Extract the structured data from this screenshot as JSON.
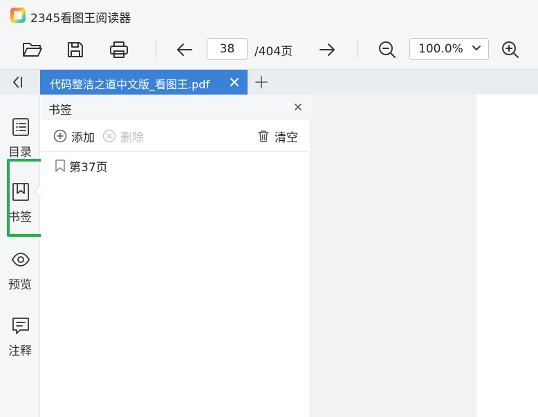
{
  "app": {
    "title": "2345看图王阅读器"
  },
  "toolbar": {
    "page_current": "38",
    "page_total": "/404页",
    "zoom": "100.0%",
    "icons": [
      "folder-open-icon",
      "save-icon",
      "print-icon",
      "arrow-left-icon",
      "arrow-right-icon",
      "zoom-out-icon",
      "chevron-down-icon",
      "zoom-in-icon"
    ]
  },
  "tabs": {
    "active_label": "代码整洁之道中文版_看图王.pdf",
    "close_icon": "close-icon",
    "add_icon": "plus-icon"
  },
  "sidebar": {
    "items": [
      {
        "label": "目录",
        "icon": "list-icon"
      },
      {
        "label": "书签",
        "icon": "bookmark-icon",
        "selected": true
      },
      {
        "label": "预览",
        "icon": "eye-icon"
      },
      {
        "label": "注释",
        "icon": "comment-icon"
      }
    ],
    "highlight_color": "#22b04b"
  },
  "bookmark_panel": {
    "title": "书签",
    "actions": {
      "add": "添加",
      "delete": "删除",
      "clear": "清空"
    },
    "bookmarks": [
      {
        "label": "第37页"
      }
    ]
  },
  "colors": {
    "tab_active": "#3b82d6",
    "toolbar_bg": "#f5f6f8"
  }
}
